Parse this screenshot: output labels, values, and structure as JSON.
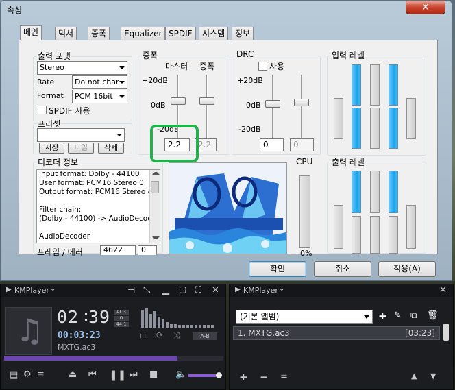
{
  "dialog": {
    "title": "속성",
    "close_label": "✕",
    "tabs": [
      "메인",
      "믹서",
      "증폭",
      "Equalizer",
      "SPDIF",
      "시스템",
      "정보"
    ],
    "output_format": {
      "group_label": "출력 포맷",
      "mode_value": "Stereo",
      "rate_label": "Rate",
      "rate_value": "Do not char",
      "format_label": "Format",
      "format_value": "PCM 16bit",
      "spdif_label": "SPDIF 사용"
    },
    "presets": {
      "group_label": "프리셋",
      "combo_value": "",
      "save_label": "저장",
      "file_label": "파일",
      "delete_label": "삭제"
    },
    "gain": {
      "group_label": "증폭",
      "master_label": "마스터",
      "gain_label": "증폭",
      "top_label": "+20dB",
      "mid_label": "0dB",
      "bottom_label": "-20dB",
      "master_value": "2.2",
      "gain_value": "2.2"
    },
    "drc": {
      "group_label": "DRC",
      "use_label": "사용",
      "top_label": "+20dB",
      "mid_label": "0dB",
      "bottom_label": "-20dB",
      "value1": "0",
      "value2": "0"
    },
    "input_levels": {
      "group_label": "입력 레벨"
    },
    "output_levels": {
      "group_label": "출력 레벨"
    },
    "decoder": {
      "group_label": "디코더 정보",
      "lines": [
        "Input format: Dolby - 44100",
        "User format: PCM16 Stereo 0",
        "Output format: PCM16 Stereo 441",
        "",
        "Filter chain:",
        "(Dolby - 44100) -> AudioDecoder -",
        "",
        "AudioDecoder"
      ],
      "frames_label": "프레임 / 에러",
      "frames_value": "4622",
      "errors_value": "0"
    },
    "cpu": {
      "label": "CPU",
      "value": "0%"
    },
    "buttons": {
      "ok": "확인",
      "cancel": "취소",
      "apply": "적용(A)"
    }
  },
  "player": {
    "title": "KMPlayer",
    "time_big_min": "02",
    "time_big_sec": "39",
    "time_small": "00:03:23",
    "file_name": "MXTG.ac3",
    "badges": [
      "AC3",
      "0",
      "44.1"
    ],
    "ab_label": "A-B"
  },
  "playlist": {
    "title": "KMPlayer",
    "album_value": "(기본 앨범)",
    "items": [
      {
        "name": "1. MXTG.ac3",
        "duration": "[03:23]"
      }
    ]
  },
  "colors": {
    "highlight": "#22b14c",
    "meter_blue": "#1aa3e8",
    "seek_bar": "#6b45b0",
    "volume_bar": "#8a5cd6"
  }
}
